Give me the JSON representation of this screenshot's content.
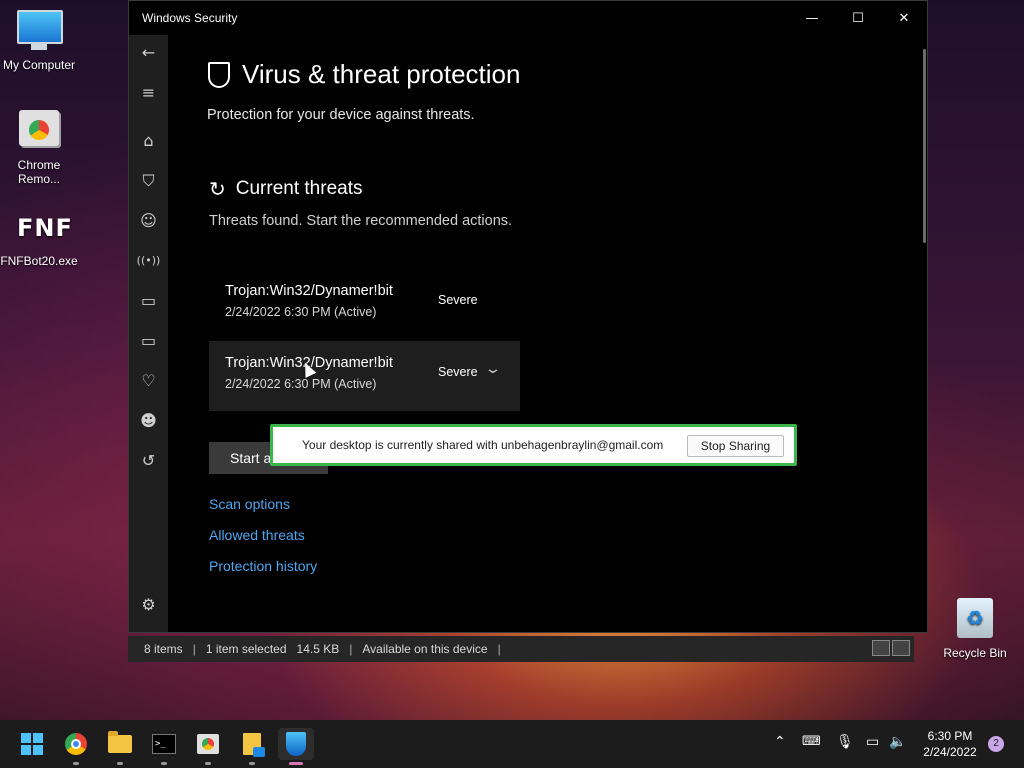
{
  "desktop": {
    "icons": [
      {
        "label": "My Computer",
        "icon": "computer-icon"
      },
      {
        "label": "Chrome Remo...",
        "icon": "chrome-remote-desktop-icon"
      },
      {
        "label": "FNFBot20.exe",
        "icon": "fnf-app-icon",
        "glyph_text": "FNF"
      },
      {
        "label": "Recycle Bin",
        "icon": "recycle-bin-icon"
      }
    ]
  },
  "window": {
    "title": "Windows Security",
    "controls": {
      "minimize": "—",
      "maximize": "☐",
      "close": "✕"
    },
    "sidebar": {
      "icons": [
        "back-arrow-icon",
        "menu-icon",
        "home-icon",
        "shield-icon",
        "account-icon",
        "network-icon",
        "app-browser-icon",
        "device-icon",
        "health-icon",
        "family-icon",
        "history-icon",
        "settings-icon"
      ],
      "glyphs": {
        "back": "←",
        "menu": "≡",
        "home": "⌂",
        "shield": "⛉",
        "account": "☺",
        "network": "((•))",
        "app": "▭",
        "device": "▭",
        "health": "♡",
        "family": "☻",
        "history": "↺",
        "settings": "⚙"
      }
    },
    "page_title": "Virus & threat protection",
    "page_subtitle": "Protection for your device against threats.",
    "section_title": "Current threats",
    "section_subtitle": "Threats found. Start the recommended actions.",
    "threats": [
      {
        "name": "Trojan:Win32/Dynamer!bit",
        "time": "2/24/2022 6:30 PM (Active)",
        "severity": "Severe"
      },
      {
        "name": "Trojan:Win32/Dynamer!bit",
        "time": "2/24/2022 6:30 PM (Active)",
        "severity": "Severe"
      }
    ],
    "start_button_label": "Start a",
    "links": [
      "Scan options",
      "Allowed threats",
      "Protection history"
    ]
  },
  "share_banner": {
    "message": "Your desktop is currently shared with unbehagenbraylin@gmail.com",
    "stop_label": "Stop Sharing",
    "border_color": "#3cb54a"
  },
  "statusbar": {
    "items_count": "8 items",
    "selected": "1 item selected",
    "size": "14.5 KB",
    "availability": "Available on this device"
  },
  "taskbar": {
    "apps": [
      "start-icon",
      "chrome-icon",
      "file-explorer-icon",
      "terminal-icon",
      "chrome-remote-desktop-icon",
      "notepad-icon",
      "windows-security-icon"
    ],
    "time": "6:30 PM",
    "date": "2/24/2022",
    "notification_count": "2"
  },
  "colors": {
    "accent_link": "#4ea7f0",
    "taskbar_bg": "#1c1c1c",
    "window_bg": "#000000"
  }
}
